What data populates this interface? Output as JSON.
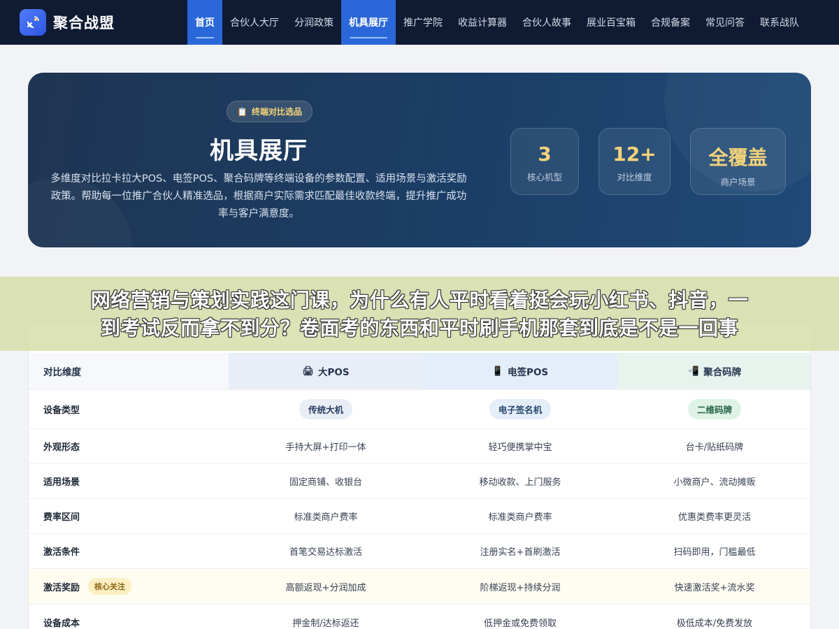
{
  "brand": {
    "name": "聚合战盟"
  },
  "nav": {
    "items": [
      {
        "label": "首页",
        "active": true
      },
      {
        "label": "合伙人大厅",
        "active": false
      },
      {
        "label": "分润政策",
        "active": false
      },
      {
        "label": "机具展厅",
        "active": true
      },
      {
        "label": "推广学院",
        "active": false
      },
      {
        "label": "收益计算器",
        "active": false
      },
      {
        "label": "合伙人故事",
        "active": false
      },
      {
        "label": "展业百宝箱",
        "active": false
      },
      {
        "label": "合规备案",
        "active": false
      },
      {
        "label": "常见问答",
        "active": false
      },
      {
        "label": "联系战队",
        "active": false
      }
    ]
  },
  "hero": {
    "badge": "终端对比选品",
    "title": "机具展厅",
    "description": "多维度对比拉卡拉大POS、电签POS、聚合码牌等终端设备的参数配置、适用场景与激活奖励政策。帮助每一位推广合伙人精准选品，根据商户实际需求匹配最佳收款终端，提升推广成功率与客户满意度。",
    "stats": [
      {
        "value": "3",
        "label": "核心机型"
      },
      {
        "value": "12+",
        "label": "对比维度"
      },
      {
        "value": "全覆盖",
        "label": "商户场景"
      }
    ]
  },
  "overlay": {
    "line1": "网络营销与策划实践这门课，为什么有人平时看着挺会玩小红书、抖音，一",
    "line2": "到考试反而拿不到分？卷面考的东西和平时刷手机那套到底是不是一回事"
  },
  "table": {
    "header": {
      "dimension": "对比维度",
      "col1": {
        "icon": "pos-terminal-icon",
        "glyph": "🖨",
        "label": "大POS"
      },
      "col2": {
        "icon": "phone-device-icon",
        "glyph": "📱",
        "label": "电签POS"
      },
      "col3": {
        "icon": "qr-code-plate-icon",
        "glyph": "📲",
        "label": "聚合码牌"
      }
    },
    "focus_badge": "核心关注",
    "rows": [
      {
        "dimension": "设备类型",
        "col1": "传统大机",
        "col2": "电子签名机",
        "col3": "二维码牌"
      },
      {
        "dimension": "外观形态",
        "col1": "手持大屏+打印一体",
        "col2": "轻巧便携掌中宝",
        "col3": "台卡/贴纸码牌"
      },
      {
        "dimension": "适用场景",
        "col1": "固定商铺、收银台",
        "col2": "移动收款、上门服务",
        "col3": "小微商户、流动摊贩"
      },
      {
        "dimension": "费率区间",
        "col1": "标准类商户费率",
        "col2": "标准类商户费率",
        "col3": "优惠类费率更灵活"
      },
      {
        "dimension": "激活条件",
        "col1": "首笔交易达标激活",
        "col2": "注册实名+首刷激活",
        "col3": "扫码即用，门槛最低"
      },
      {
        "dimension": "激活奖励",
        "col1": "高额返现+分润加成",
        "col2": "阶梯返现+持续分润",
        "col3": "快速激活奖+流水奖"
      },
      {
        "dimension": "设备成本",
        "col1": "押金制/达标返还",
        "col2": "低押金或免费领取",
        "col3": "极低成本/免费发放"
      }
    ]
  }
}
